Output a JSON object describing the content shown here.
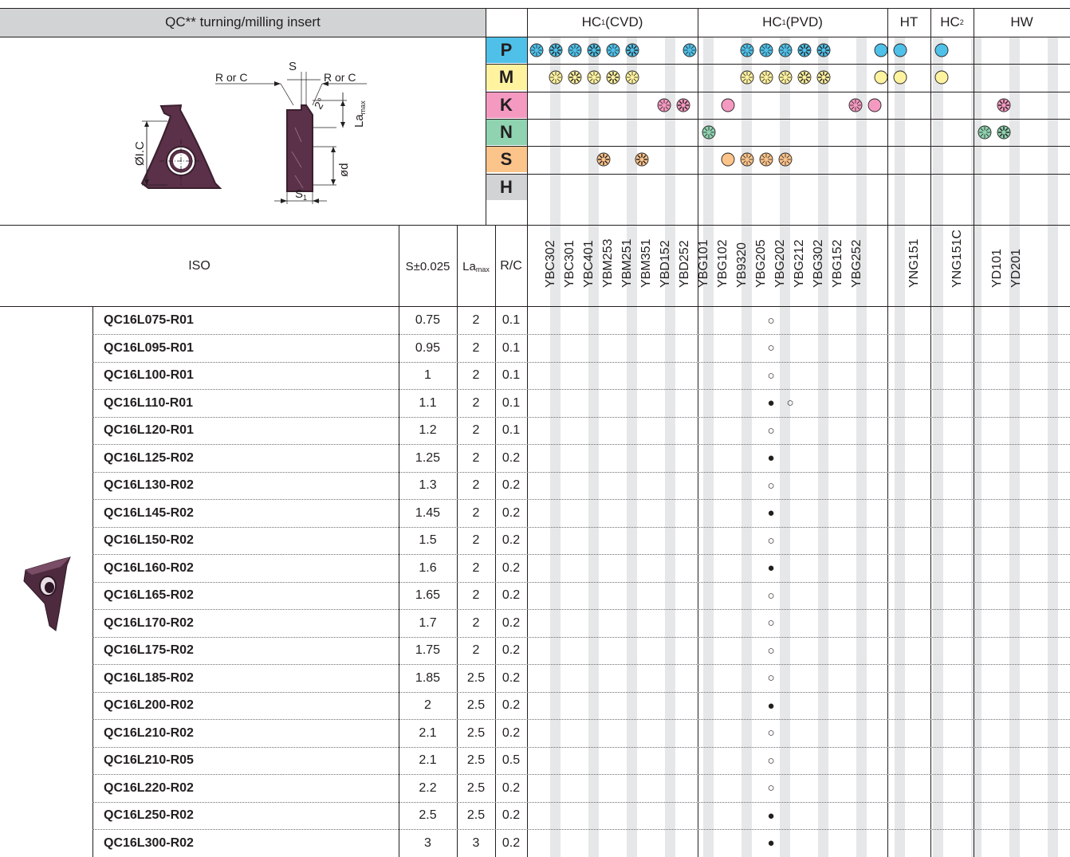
{
  "header": {
    "title": "QC** turning/milling insert",
    "groups": [
      {
        "pre": "HC",
        "sup": "1",
        "post": " (CVD)"
      },
      {
        "pre": "HC",
        "sup": "1",
        "post": " (PVD)"
      },
      {
        "pre": "HT",
        "sup": "",
        "post": ""
      },
      {
        "pre": "HC",
        "sup": "2",
        "post": ""
      },
      {
        "pre": "HW",
        "sup": "",
        "post": ""
      }
    ]
  },
  "drawing": {
    "labels": {
      "s": "S",
      "r_or_c": "R or C",
      "angle": "2°",
      "la": "La",
      "la_sub": "max",
      "d": "ød",
      "ic": "ØI.C",
      "s1": "S",
      "s1_sub": "1"
    }
  },
  "materials": [
    {
      "letter": "P",
      "color": "#4fc1e9"
    },
    {
      "letter": "M",
      "color": "#fff3a0"
    },
    {
      "letter": "K",
      "color": "#f49ac1"
    },
    {
      "letter": "N",
      "color": "#8fd3b0"
    },
    {
      "letter": "S",
      "color": "#fbc48a"
    },
    {
      "letter": "H",
      "color": "#d1d3d4"
    }
  ],
  "columns": {
    "iso": "ISO",
    "s_pre": "S",
    "s_tol": "±0.025",
    "la": "La",
    "la_sub": "max",
    "rc": "R/C"
  },
  "grades": [
    "YBC302",
    "YBC301",
    "YBC401",
    "YBM253",
    "YBM251",
    "YBM351",
    "YBD152",
    "YBD252",
    "YBG101",
    "YBG102",
    "YB9320",
    "YBG205",
    "YBG202",
    "YBG212",
    "YBG302",
    "YBG152",
    "YBG252",
    "YNG151",
    "YNG151C",
    "YD101",
    "YD201"
  ],
  "symbols": {
    "first": "●",
    "alt": "○"
  },
  "rows": [
    {
      "iso": "QC16L075-R01",
      "s": "0.75",
      "la": "2",
      "rc": "0.1",
      "mark": "○",
      "extra": ""
    },
    {
      "iso": "QC16L095-R01",
      "s": "0.95",
      "la": "2",
      "rc": "0.1",
      "mark": "○",
      "extra": ""
    },
    {
      "iso": "QC16L100-R01",
      "s": "1",
      "la": "2",
      "rc": "0.1",
      "mark": "○",
      "extra": ""
    },
    {
      "iso": "QC16L110-R01",
      "s": "1.1",
      "la": "2",
      "rc": "0.1",
      "mark": "●",
      "extra": "○"
    },
    {
      "iso": "QC16L120-R01",
      "s": "1.2",
      "la": "2",
      "rc": "0.1",
      "mark": "○",
      "extra": ""
    },
    {
      "iso": "QC16L125-R02",
      "s": "1.25",
      "la": "2",
      "rc": "0.2",
      "mark": "●",
      "extra": ""
    },
    {
      "iso": "QC16L130-R02",
      "s": "1.3",
      "la": "2",
      "rc": "0.2",
      "mark": "○",
      "extra": ""
    },
    {
      "iso": "QC16L145-R02",
      "s": "1.45",
      "la": "2",
      "rc": "0.2",
      "mark": "●",
      "extra": ""
    },
    {
      "iso": "QC16L150-R02",
      "s": "1.5",
      "la": "2",
      "rc": "0.2",
      "mark": "○",
      "extra": ""
    },
    {
      "iso": "QC16L160-R02",
      "s": "1.6",
      "la": "2",
      "rc": "0.2",
      "mark": "●",
      "extra": ""
    },
    {
      "iso": "QC16L165-R02",
      "s": "1.65",
      "la": "2",
      "rc": "0.2",
      "mark": "○",
      "extra": ""
    },
    {
      "iso": "QC16L170-R02",
      "s": "1.7",
      "la": "2",
      "rc": "0.2",
      "mark": "○",
      "extra": ""
    },
    {
      "iso": "QC16L175-R02",
      "s": "1.75",
      "la": "2",
      "rc": "0.2",
      "mark": "○",
      "extra": ""
    },
    {
      "iso": "QC16L185-R02",
      "s": "1.85",
      "la": "2.5",
      "rc": "0.2",
      "mark": "○",
      "extra": ""
    },
    {
      "iso": "QC16L200-R02",
      "s": "2",
      "la": "2.5",
      "rc": "0.2",
      "mark": "●",
      "extra": ""
    },
    {
      "iso": "QC16L210-R02",
      "s": "2.1",
      "la": "2.5",
      "rc": "0.2",
      "mark": "○",
      "extra": ""
    },
    {
      "iso": "QC16L210-R05",
      "s": "2.1",
      "la": "2.5",
      "rc": "0.5",
      "mark": "○",
      "extra": ""
    },
    {
      "iso": "QC16L220-R02",
      "s": "2.2",
      "la": "2.5",
      "rc": "0.2",
      "mark": "○",
      "extra": ""
    },
    {
      "iso": "QC16L250-R02",
      "s": "2.5",
      "la": "2.5",
      "rc": "0.2",
      "mark": "●",
      "extra": ""
    },
    {
      "iso": "QC16L300-R02",
      "s": "3",
      "la": "3",
      "rc": "0.2",
      "mark": "●",
      "extra": ""
    }
  ]
}
